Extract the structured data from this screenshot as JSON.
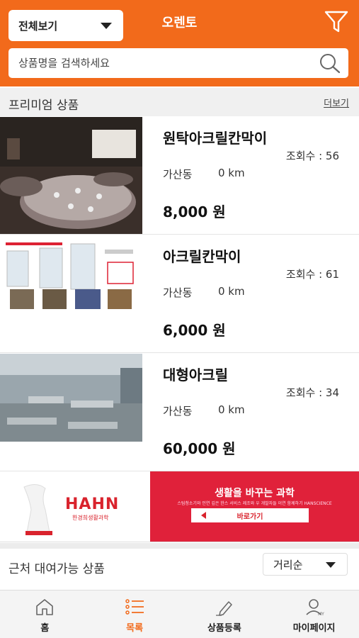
{
  "header": {
    "title": "오렌토",
    "category_select": "전체보기",
    "search_placeholder": "상품명을 검색하세요",
    "accent_color": "#f26a1b",
    "filter_icon": "filter-icon",
    "search_icon": "search-icon"
  },
  "premium": {
    "title": "프리미엄 상품",
    "more": "더보기",
    "items": [
      {
        "name": "원탁아크릴칸막이",
        "views": "조회수 : 56",
        "location": "가산동",
        "distance": "0 km",
        "price": "8,000 원"
      },
      {
        "name": "아크릴칸막이",
        "views": "조회수 : 61",
        "location": "가산동",
        "distance": "0 km",
        "price": "6,000 원"
      },
      {
        "name": "대형아크릴",
        "views": "조회수 : 34",
        "location": "가산동",
        "distance": "0 km",
        "price": "60,000 원"
      }
    ]
  },
  "banner": {
    "brand": "HAHN",
    "brand_sub": "한경희생활과학",
    "headline": "생활을 바꾸는 과학",
    "description": "스팀청소기와 인연 깊은 한스 서비스 제조와 우 개발자들 이연 함께하기 HANSCIENCE",
    "cta": "바로가기",
    "brand_color": "#e0213a"
  },
  "nearby": {
    "title": "근처 대여가능 상품",
    "sort": "거리순"
  },
  "bottom_nav": {
    "items": [
      {
        "label": "홈",
        "icon": "home-icon"
      },
      {
        "label": "목록",
        "icon": "list-icon",
        "active": true
      },
      {
        "label": "상품등록",
        "icon": "pencil-icon"
      },
      {
        "label": "마이페이지",
        "icon": "user-icon"
      }
    ]
  }
}
